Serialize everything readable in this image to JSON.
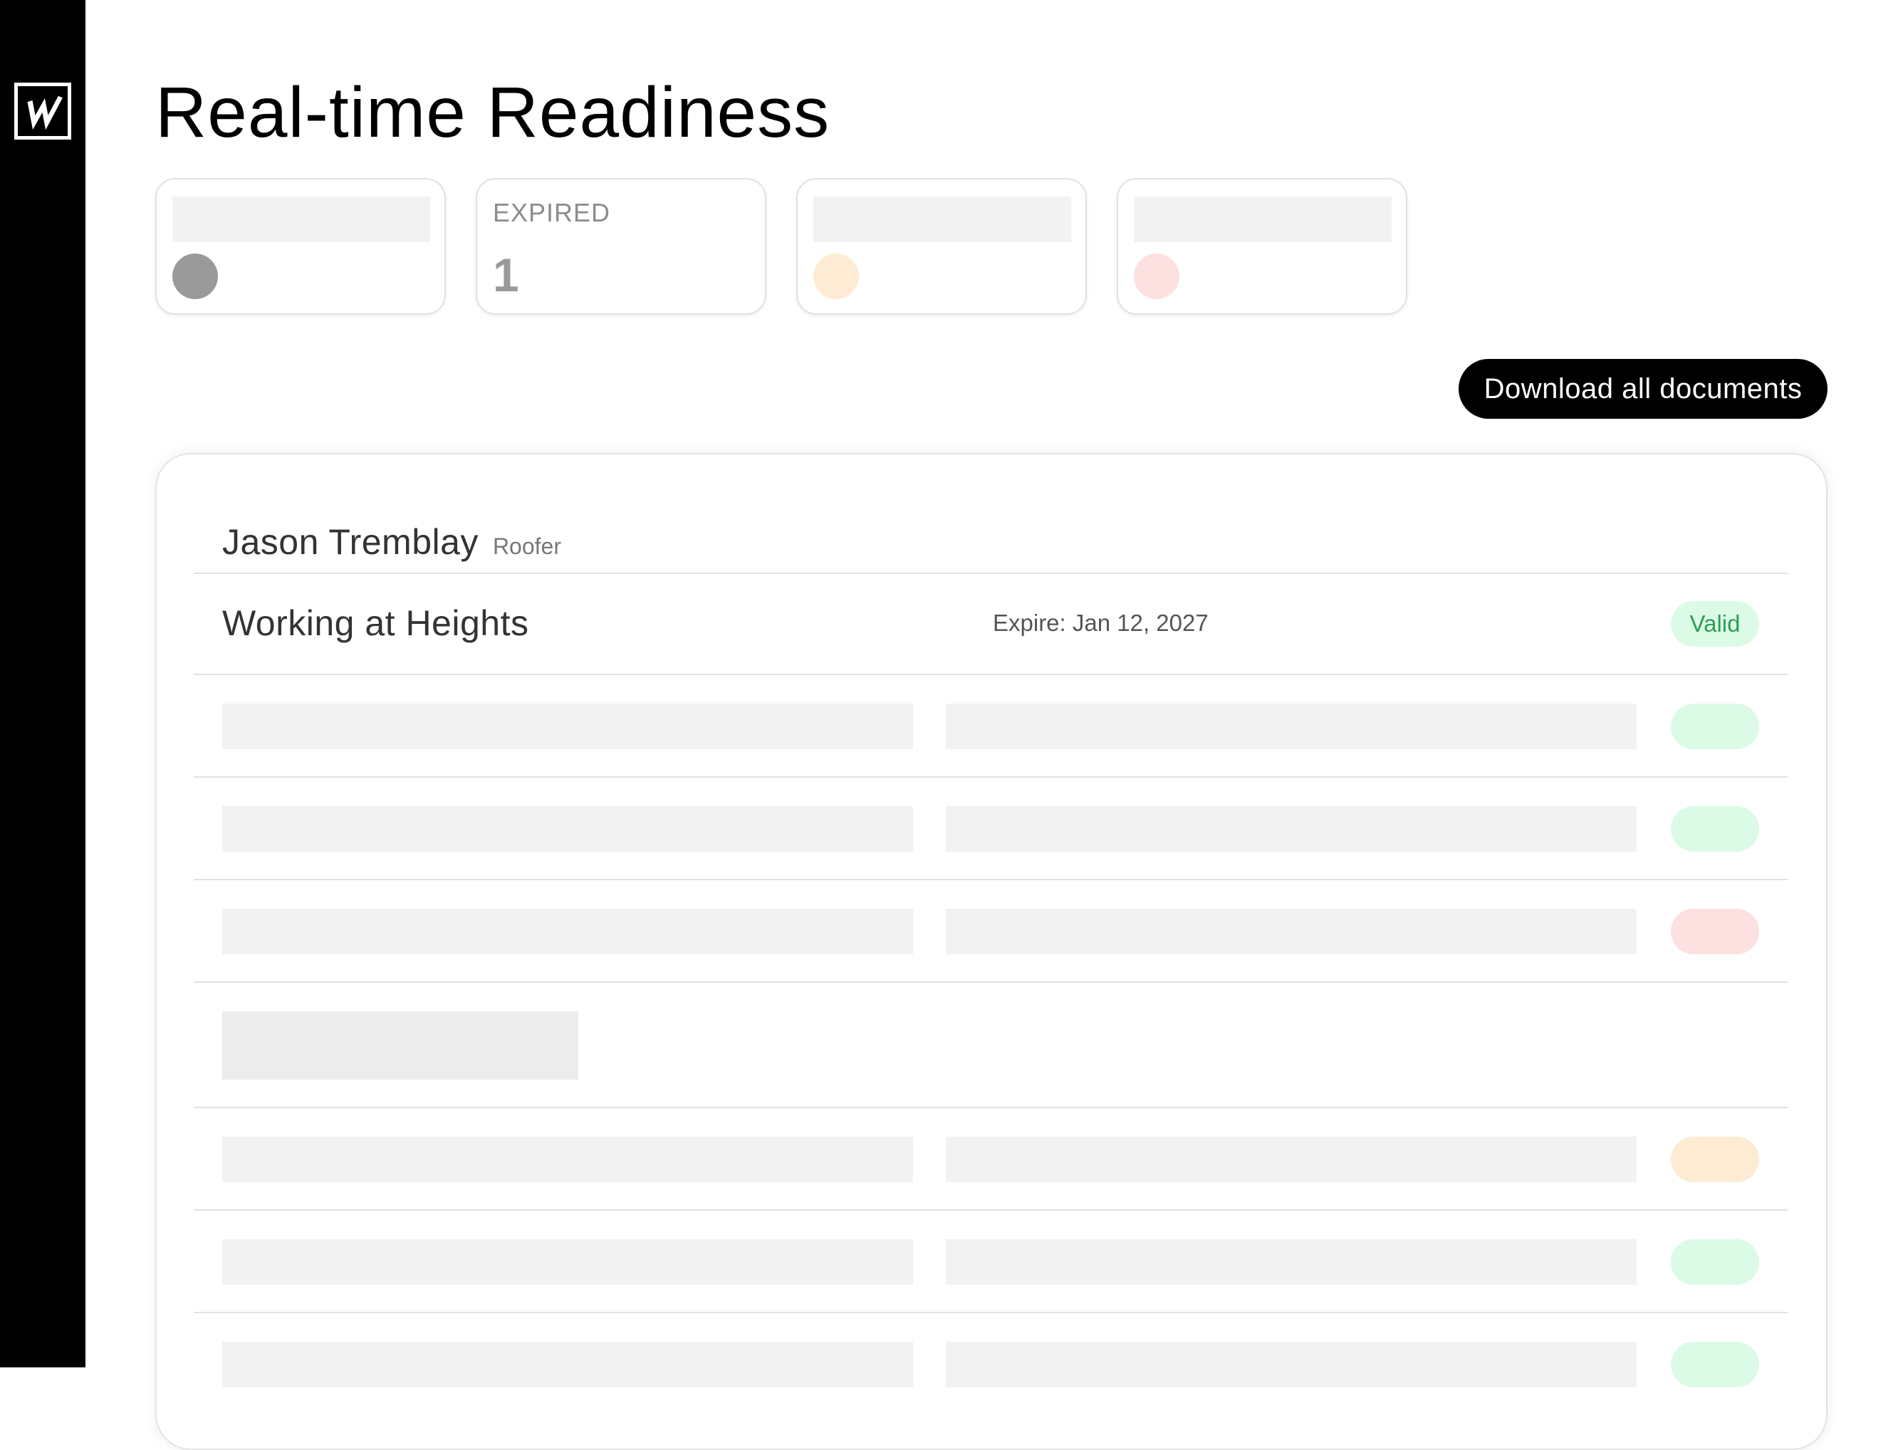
{
  "app": {
    "logo_letter": "W"
  },
  "page": {
    "title": "Real-time Readiness"
  },
  "stats": {
    "expired": {
      "label": "EXPIRED",
      "value": "1"
    },
    "dot_colors": {
      "neutral": "#9a9a9a",
      "warning": "#fdebd3",
      "danger": "#fde0e0"
    }
  },
  "actions": {
    "download_label": "Download all documents"
  },
  "worker": {
    "name": "Jason Tremblay",
    "role": "Roofer"
  },
  "documents": {
    "first": {
      "title": "Working at Heights",
      "expire": "Expire: Jan 12, 2027",
      "status": "Valid"
    },
    "status_colors": {
      "valid": "#dcfbe6",
      "expiring": "#fdebd3",
      "expired": "#fde0e0"
    }
  }
}
